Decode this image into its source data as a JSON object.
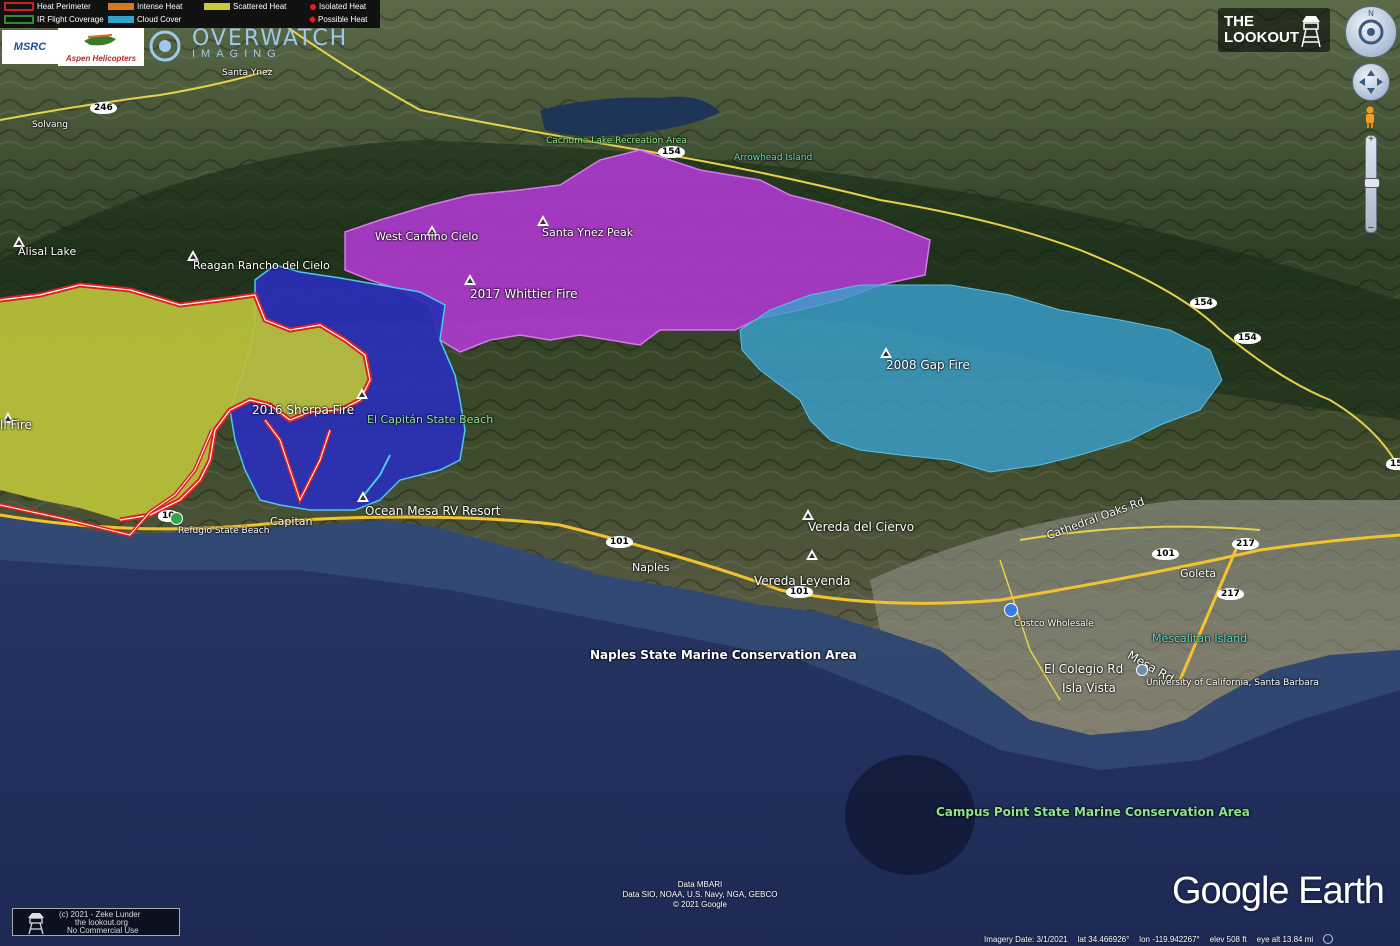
{
  "legend": {
    "items": [
      {
        "label": "Heat Perimeter",
        "color": "#cc2020"
      },
      {
        "label": "Intense Heat",
        "color": "#d37a20"
      },
      {
        "label": "Scattered Heat",
        "color": "#c8c83a"
      },
      {
        "label": "Isolated Heat",
        "color": "#e02020"
      },
      {
        "label": "IR Flight Coverage",
        "color": "#2e8b3a"
      },
      {
        "label": "Cloud Cover",
        "color": "#2fa4c8"
      },
      {
        "label": "Possible Heat",
        "color": "#e02020"
      }
    ]
  },
  "logos": {
    "msrc": "MSRC",
    "aspen": "Aspen Helicopters",
    "overwatch_title": "OVERWATCH",
    "overwatch_sub": "IMAGING"
  },
  "lookout": {
    "line1": "THE",
    "line2": "LOOKOUT"
  },
  "places": {
    "santa_ynez": "Santa Ynez",
    "solvang": "Solvang",
    "cachuma": "Cachuma Lake Recreation Area",
    "arrowhead": "Arrowhead Island",
    "alisal": "Alisal Lake",
    "reagan": "Reagan Rancho del Cielo",
    "west_camino": "West Camino Cielo",
    "santa_ynez_peak": "Santa Ynez Peak",
    "whittier": "2017 Whittier Fire",
    "gap": "2008 Gap Fire",
    "sherpa": "2016 Sherpa Fire",
    "el_capitan": "El Capitán State Beach",
    "fire_left": "ll Fire",
    "refugio": "Refugio State Beach",
    "capitan": "Capitan",
    "ocean_mesa": "Ocean Mesa RV Resort",
    "naples": "Naples",
    "vereda_ciervo": "Vereda del Ciervo",
    "vereda_leyenda": "Vereda Leyenda",
    "cathedral_oaks": "Cathedral Oaks Rd",
    "goleta": "Goleta",
    "costco": "Costco Wholesale",
    "mescalitan": "Mescalitan Island",
    "el_colegio": "El Colegio Rd",
    "mesa_rd": "Mesa Rd",
    "isla_vista": "Isla Vista",
    "ucsb": "University of California, Santa Barbara",
    "naples_smca": "Naples State Marine Conservation Area",
    "campus_point": "Campus Point State Marine Conservation Area"
  },
  "shields": {
    "r246": "246",
    "r154a": "154",
    "r154b": "154",
    "r154c": "154",
    "r154d": "15",
    "r101a": "101",
    "r101b": "101",
    "r101c": "101",
    "r101d": "10",
    "r217a": "217",
    "r217b": "217"
  },
  "copyright": {
    "line1": "(c) 2021 - Zeke Lunder",
    "line2": "the lookout.org",
    "line3": "No Commercial Use"
  },
  "attribution": {
    "line1": "Data MBARI",
    "line2": "Data SIO, NOAA, U.S. Navy, NGA, GEBCO",
    "line3": "© 2021 Google"
  },
  "google_earth": "Google Earth",
  "status": {
    "date": "Imagery Date: 3/1/2021",
    "lat": "lat  34.466926°",
    "lon": "lon -119.942267°",
    "elev": "elev  508 ft",
    "eye": "eye alt  13.84 mi"
  },
  "colors": {
    "ocean": "#25335c",
    "land": "#4a5a35",
    "whittier": "#b13bd4",
    "gap": "#3a9bc4",
    "sherpa_blue": "#2a2fb8",
    "yellow_fire": "#b9c23a",
    "heat_red": "#e0201e"
  }
}
